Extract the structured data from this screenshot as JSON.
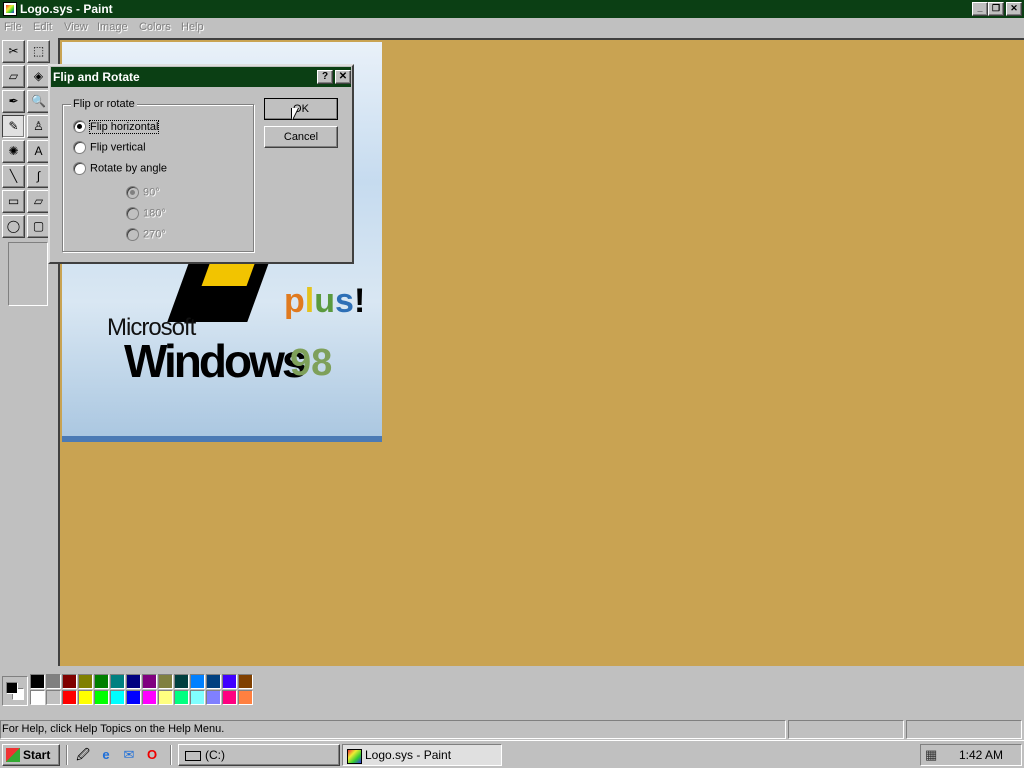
{
  "window": {
    "title": "Logo.sys - Paint"
  },
  "menu": [
    "File",
    "Edit",
    "View",
    "Image",
    "Colors",
    "Help"
  ],
  "tools": [
    {
      "name": "free-form-select",
      "glyph": "✂"
    },
    {
      "name": "select",
      "glyph": "⬚"
    },
    {
      "name": "eraser",
      "glyph": "▱"
    },
    {
      "name": "fill",
      "glyph": "◈"
    },
    {
      "name": "pick-color",
      "glyph": "✒"
    },
    {
      "name": "magnifier",
      "glyph": "🔍"
    },
    {
      "name": "pencil",
      "glyph": "✎"
    },
    {
      "name": "brush",
      "glyph": "♙"
    },
    {
      "name": "airbrush",
      "glyph": "✺"
    },
    {
      "name": "text",
      "glyph": "A"
    },
    {
      "name": "line",
      "glyph": "╲"
    },
    {
      "name": "curve",
      "glyph": "∫"
    },
    {
      "name": "rectangle",
      "glyph": "▭"
    },
    {
      "name": "polygon",
      "glyph": "▱"
    },
    {
      "name": "ellipse",
      "glyph": "◯"
    },
    {
      "name": "rounded-rectangle",
      "glyph": "▢"
    }
  ],
  "image": {
    "microsoft": "Microsoft",
    "windows": "Windows",
    "plus": "plus!",
    "version": "98"
  },
  "dialog": {
    "title": "Flip and Rotate",
    "help_btn": "?",
    "close_btn": "✕",
    "group_label": "Flip or rotate",
    "options": {
      "flip_horizontal": "Flip horizontal",
      "flip_vertical": "Flip vertical",
      "rotate_by_angle": "Rotate by angle"
    },
    "angles": {
      "a90": "90°",
      "a180": "180°",
      "a270": "270°"
    },
    "ok": "OK",
    "cancel": "Cancel",
    "selected": "Flip horizontal"
  },
  "palette": {
    "row1": [
      "#000000",
      "#808080",
      "#800000",
      "#808000",
      "#008000",
      "#008080",
      "#000080",
      "#800080",
      "#808040",
      "#004040",
      "#0080ff",
      "#004080",
      "#4000ff",
      "#804000"
    ],
    "row2": [
      "#ffffff",
      "#c0c0c0",
      "#ff0000",
      "#ffff00",
      "#00ff00",
      "#00ffff",
      "#0000ff",
      "#ff00ff",
      "#ffff80",
      "#00ff80",
      "#80ffff",
      "#8080ff",
      "#ff0080",
      "#ff8040"
    ],
    "foreground": "#000000",
    "background": "#ffffff"
  },
  "status": {
    "text": "For Help, click Help Topics on the Help Menu."
  },
  "taskbar": {
    "start": "Start",
    "buttons": [
      "(C:)",
      "Logo.sys - Paint"
    ],
    "clock": "1:42 AM"
  }
}
